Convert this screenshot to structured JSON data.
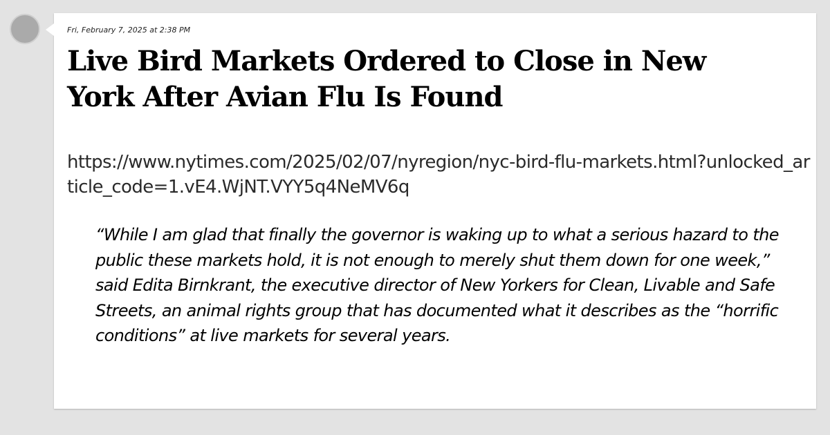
{
  "post": {
    "timestamp": "Fri, February 7, 2025 at 2:38 PM",
    "title": "Live Bird Markets Ordered to Close in New York After Avian Flu Is Found",
    "url": "https://www.nytimes.com/2025/02/07/nyregion/nyc-bird-flu-markets.html?unlocked_article_code=1.vE4.WjNT.VYY5q4NeMV6q",
    "quote": "“While I am glad that finally the governor is waking up to what a serious hazard to the public these markets hold, it is not enough to merely shut them down for one week,” said Edita Birnkrant, the executive director of New Yorkers for Clean, Livable and Safe Streets, an animal rights group that has documented what it describes as the “horrific conditions” at live markets for several years."
  },
  "colors": {
    "page_background": "#e3e3e3",
    "card_background": "#ffffff",
    "avatar": "#aaaaaa"
  }
}
